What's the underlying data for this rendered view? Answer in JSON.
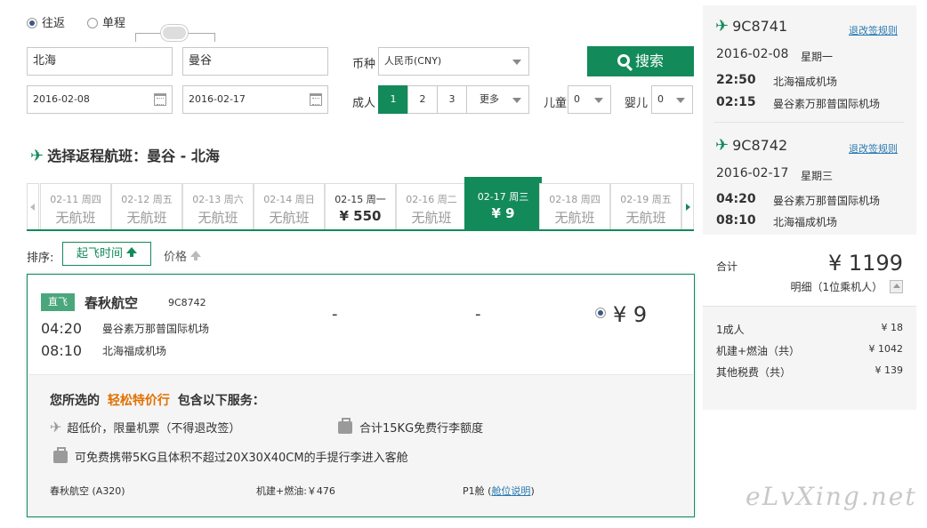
{
  "trip": {
    "roundtrip_label": "往返",
    "oneway_label": "单程"
  },
  "search": {
    "from": "北海",
    "to": "曼谷",
    "depart_date": "2016-02-08",
    "return_date": "2016-02-17",
    "currency_label": "币种",
    "currency_value": "人民币(CNY)",
    "search_label": "搜索",
    "adult_label": "成人",
    "adult_options": [
      "1",
      "2",
      "3",
      "更多"
    ],
    "child_label": "儿童",
    "child_value": "0",
    "infant_label": "婴儿",
    "infant_value": "0"
  },
  "section_title": "选择返程航班：曼谷 - 北海",
  "dates": [
    {
      "date": "02-11 周四",
      "price": "无航班"
    },
    {
      "date": "02-12 周五",
      "price": "无航班"
    },
    {
      "date": "02-13 周六",
      "price": "无航班"
    },
    {
      "date": "02-14 周日",
      "price": "无航班"
    },
    {
      "date": "02-15 周一",
      "price": "¥ 550"
    },
    {
      "date": "02-16 周二",
      "price": "无航班"
    },
    {
      "date": "02-17 周三",
      "price": "¥ 9"
    },
    {
      "date": "02-18 周四",
      "price": "无航班"
    },
    {
      "date": "02-19 周五",
      "price": "无航班"
    }
  ],
  "sort": {
    "label": "排序:",
    "departure_label": "起飞时间",
    "price_label": "价格"
  },
  "flight": {
    "tag": "直飞",
    "airline": "春秋航空",
    "flight_no": "9C8742",
    "dep_time": "04:20",
    "dep_airport": "曼谷素万那普国际机场",
    "arr_time": "08:10",
    "arr_airport": "北海福成机场",
    "col1": "-",
    "col2": "-",
    "price": "¥ 9"
  },
  "services": {
    "intro_prefix": "您所选的",
    "intro_highlight": "轻松特价行",
    "intro_suffix": "包含以下服务：",
    "item1": "超低价，限量机票（不得退改签）",
    "item2": "合计15KG免费行李额度",
    "item3": "可免费携带5KG且体积不超过20X30X40CM的手提行李进入客舱",
    "aircraft": "春秋航空 (A320)",
    "fuel": "机建+燃油:￥476",
    "cabin": "P1舱",
    "cabin_link": "舱位说明"
  },
  "summary": {
    "rule_link": "退改签规则",
    "leg1": {
      "flight_no": "9C8741",
      "date": "2016-02-08",
      "weekday": "星期一",
      "dep_time": "22:50",
      "dep_airport": "北海福成机场",
      "arr_time": "02:15",
      "arr_airport": "曼谷素万那普国际机场"
    },
    "leg2": {
      "flight_no": "9C8742",
      "date": "2016-02-17",
      "weekday": "星期三",
      "dep_time": "04:20",
      "dep_airport": "曼谷素万那普国际机场",
      "arr_time": "08:10",
      "arr_airport": "北海福成机场"
    },
    "total_label": "合计",
    "total_value": "¥ 1199",
    "detail_label": "明细（1位乘机人）",
    "rows": [
      {
        "label": "1成人",
        "value": "¥ 18"
      },
      {
        "label": "机建+燃油（共）",
        "value": "¥ 1042"
      },
      {
        "label": "其他税费（共）",
        "value": "¥ 139"
      }
    ]
  },
  "watermark": "eLvXing.net",
  "colors": {
    "brand": "#138a5a",
    "highlight": "#e07000",
    "link": "#2a7ab0"
  }
}
